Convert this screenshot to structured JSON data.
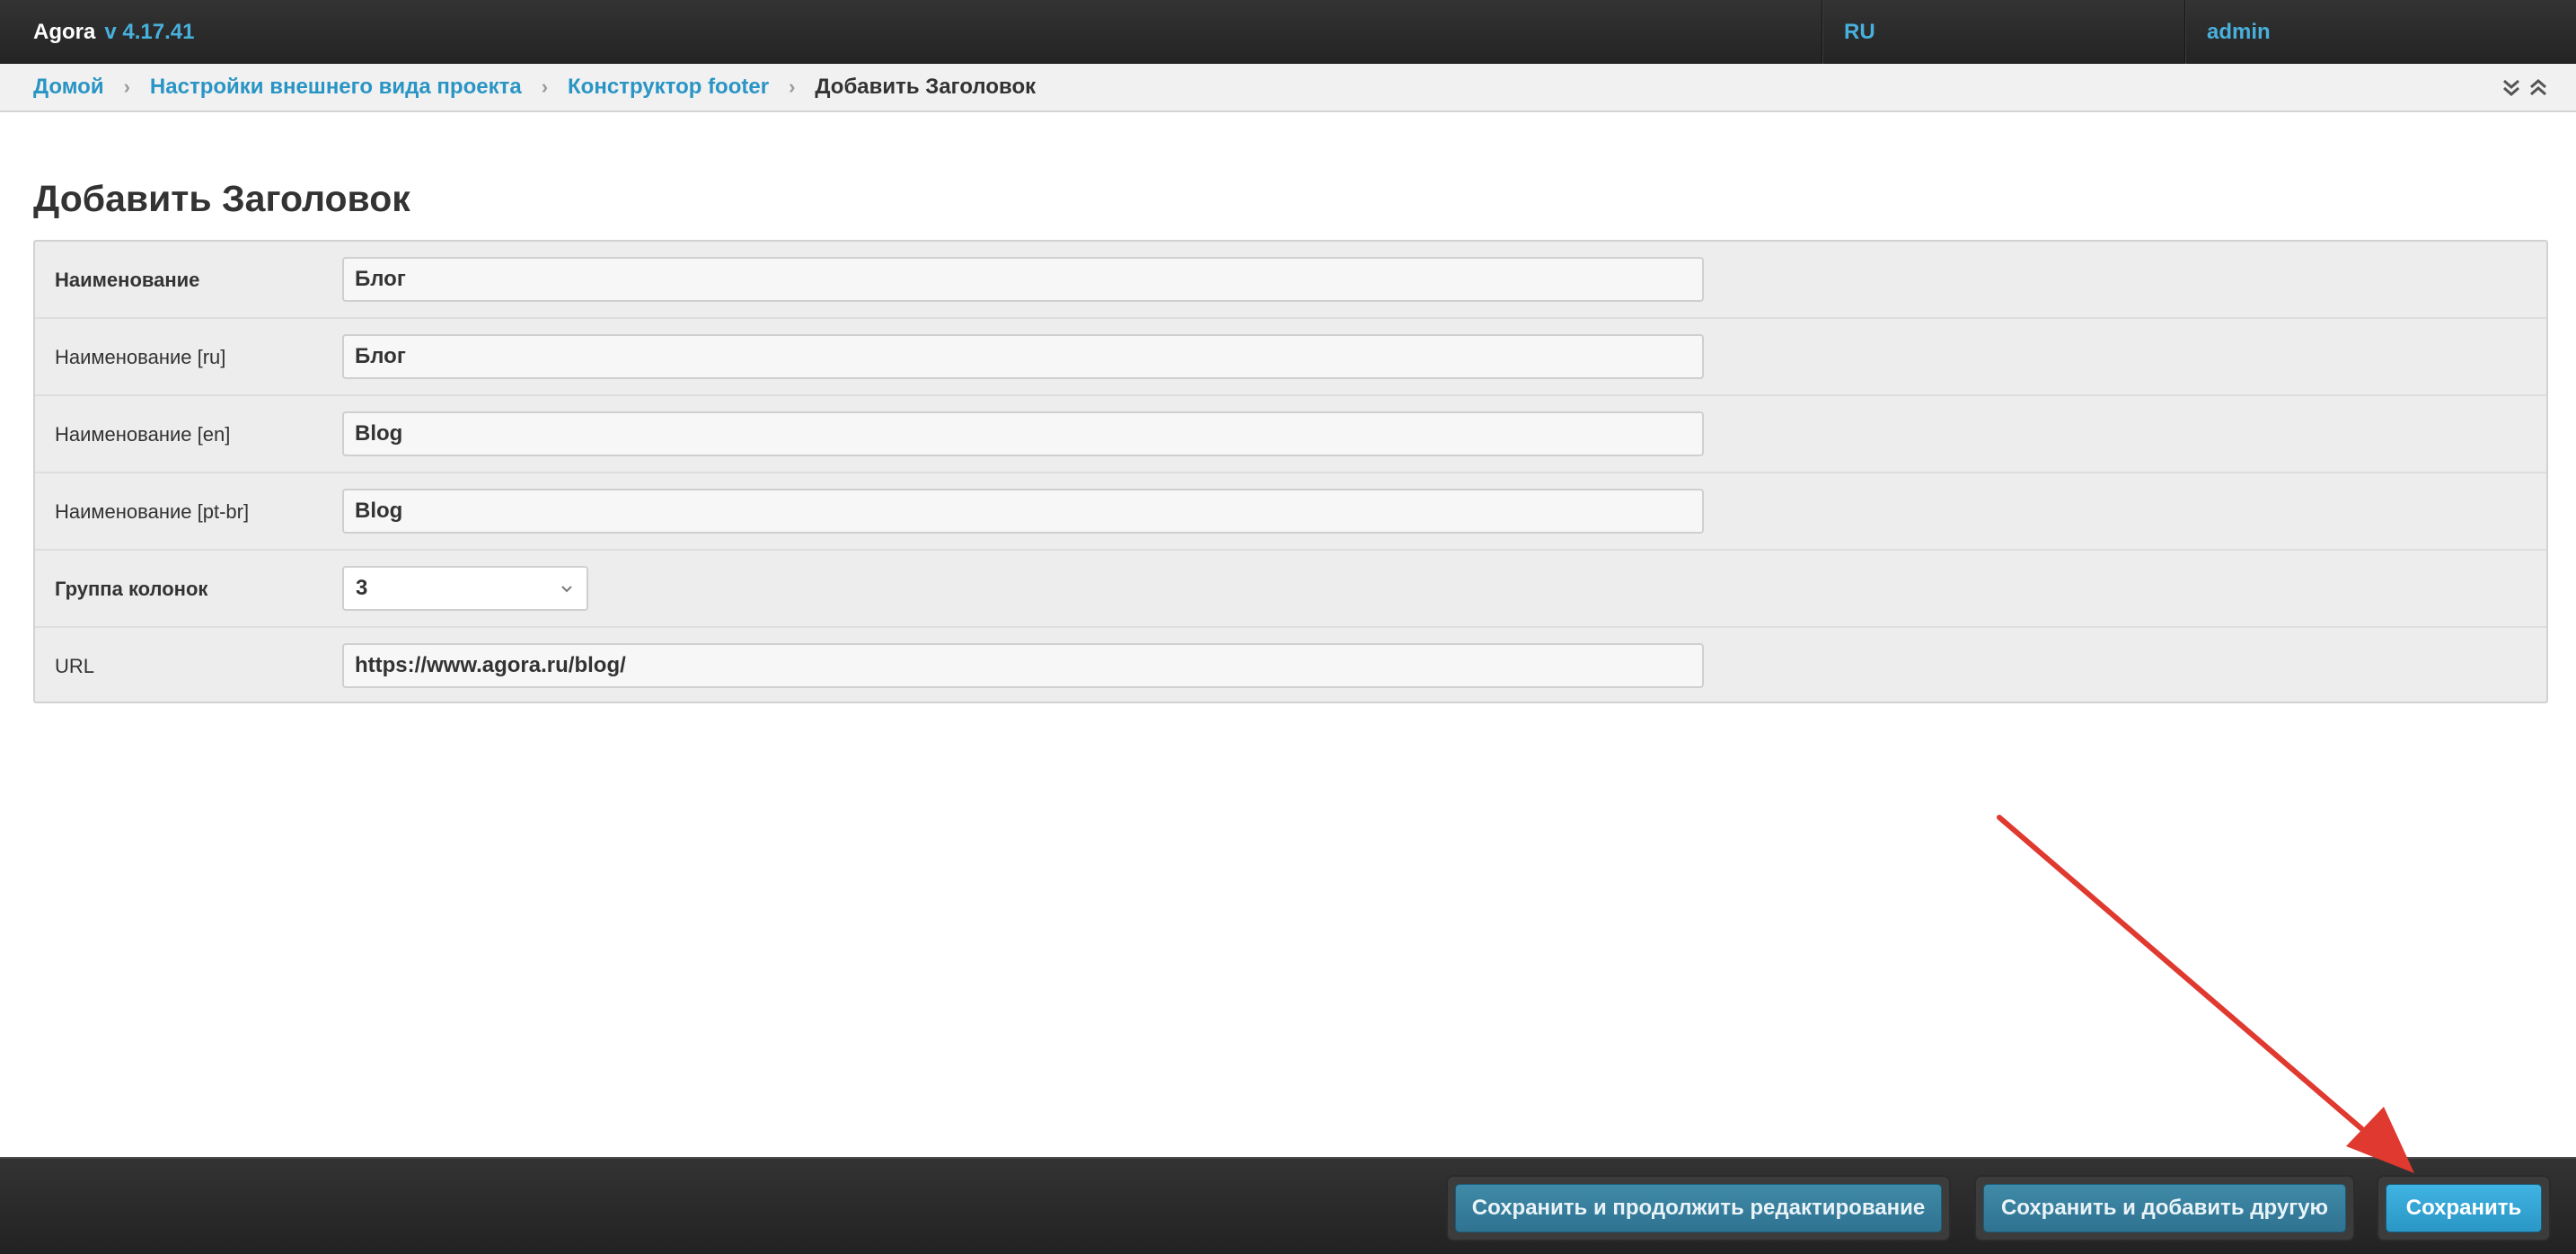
{
  "header": {
    "brand_name": "Agora",
    "version": "v 4.17.41",
    "language": "RU",
    "user": "admin"
  },
  "breadcrumbs": [
    {
      "label": "Домой"
    },
    {
      "label": "Настройки внешнего вида проекта"
    },
    {
      "label": "Конструктор footer"
    },
    {
      "label": "Добавить Заголовок"
    }
  ],
  "breadcrumb_tools": {
    "expand_icon": "double-chevron-down-icon",
    "collapse_icon": "double-chevron-up-icon"
  },
  "page": {
    "title": "Добавить Заголовок"
  },
  "form": {
    "fields": [
      {
        "label": "Наименование",
        "value": "Блог",
        "required": true
      },
      {
        "label": "Наименование [ru]",
        "value": "Блог",
        "required": false
      },
      {
        "label": "Наименование [en]",
        "value": "Blog",
        "required": false
      },
      {
        "label": "Наименование [pt-br]",
        "value": "Blog",
        "required": false
      },
      {
        "label": "Группа колонок",
        "value": "3",
        "required": true,
        "type": "select"
      },
      {
        "label": "URL",
        "value": "https://www.agora.ru/blog/",
        "required": false
      }
    ]
  },
  "actions": {
    "save_continue": "Сохранить и продолжить редактирование",
    "save_add_another": "Сохранить и добавить другую",
    "save": "Сохранить"
  },
  "colors": {
    "accent": "#2a95c5",
    "header_bg": "#2c2c2c",
    "annotation_arrow": "#e0392f"
  }
}
